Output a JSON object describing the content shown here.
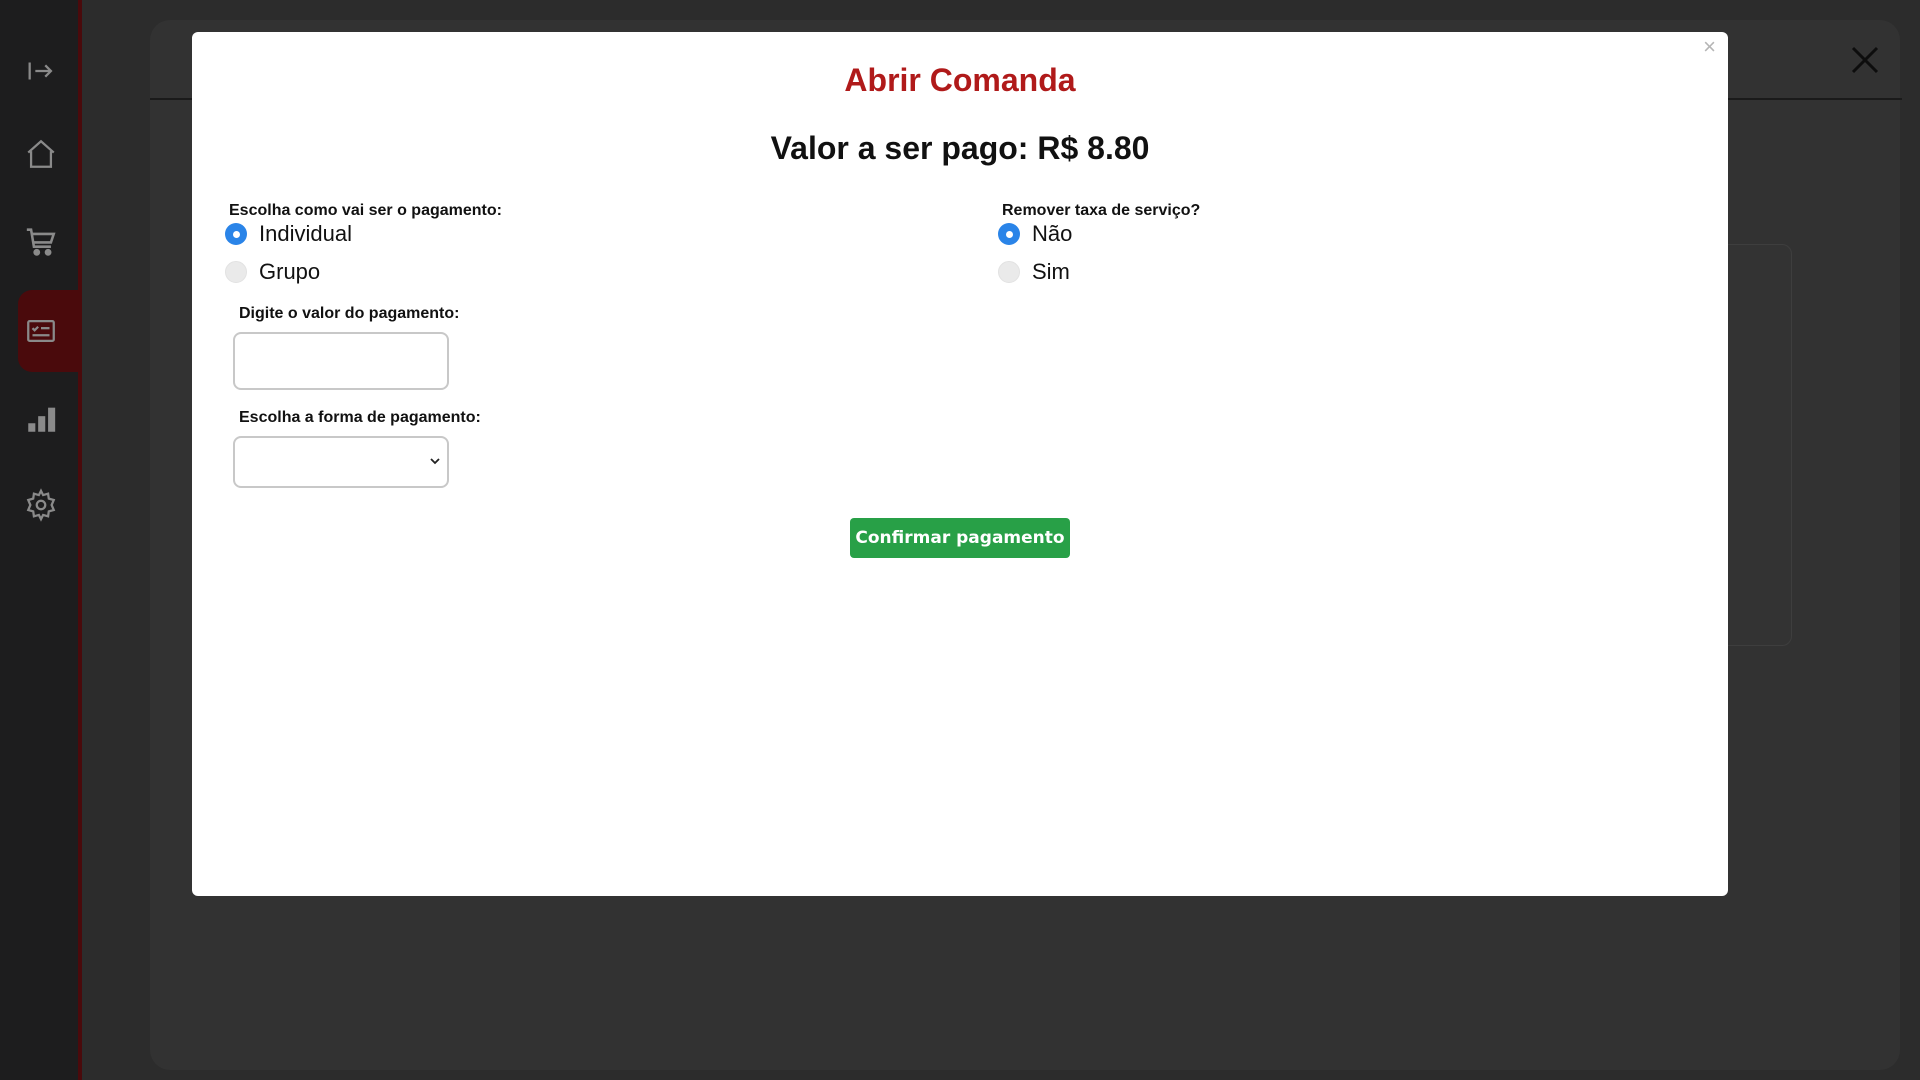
{
  "modal": {
    "title": "Abrir Comanda",
    "amount_text": "Valor a ser pago: R$ 8.80",
    "close_symbol": "×",
    "payment_type": {
      "label": "Escolha como vai ser o pagamento:",
      "options": [
        {
          "label": "Individual",
          "checked": true
        },
        {
          "label": "Grupo",
          "checked": false
        }
      ]
    },
    "service_fee": {
      "label": "Remover taxa de serviço?",
      "options": [
        {
          "label": "Não",
          "checked": true
        },
        {
          "label": "Sim",
          "checked": false
        }
      ]
    },
    "payment_value": {
      "label": "Digite o valor do pagamento:",
      "value": "",
      "placeholder": ""
    },
    "payment_method": {
      "label": "Escolha a forma de pagamento:",
      "selected": ""
    },
    "confirm_label": "Confirmar pagamento"
  },
  "sidebar": {
    "items": [
      {
        "icon": "logout-icon"
      },
      {
        "icon": "home-icon"
      },
      {
        "icon": "cart-icon"
      },
      {
        "icon": "orders-icon",
        "active": true
      },
      {
        "icon": "chart-icon"
      },
      {
        "icon": "gear-icon"
      }
    ]
  },
  "colors": {
    "title": "#b01a1a",
    "radio_checked": "#2a84e8",
    "confirm_button": "#28a047",
    "sidebar_active": "#4a0a0c"
  }
}
